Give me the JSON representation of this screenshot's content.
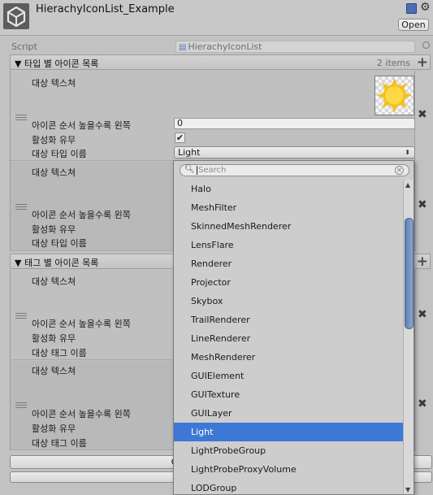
{
  "header": {
    "title": "HierachyIconList_Example",
    "open_label": "Open",
    "book_icon": "reference-book-icon",
    "gear_icon": "gear-icon"
  },
  "script_row": {
    "label": "Script",
    "value": "HierachyIconList"
  },
  "type_section": {
    "title": "타입 별 아이콘 목록",
    "count": "2 items",
    "items": [
      {
        "texture_label": "대상 텍스쳐",
        "order_label": "아이콘 순서 높을수록 왼쪽",
        "order_value": "0",
        "active_label": "활성화 유무",
        "active_checked": true,
        "type_label": "대상 타입 이름",
        "type_value": "Light"
      },
      {
        "texture_label": "대상 텍스쳐",
        "order_label": "아이콘 순서 높을수록 왼쪽",
        "active_label": "활성화 유무",
        "type_label": "대상 타입 이름"
      }
    ]
  },
  "tag_section": {
    "title": "태그 별 아이콘 목록",
    "items": [
      {
        "texture_label": "대상 텍스쳐",
        "order_label": "아이콘 순서 높을수록 왼쪽",
        "active_label": "활성화 유무",
        "tag_label": "대상 태그 이름"
      },
      {
        "texture_label": "대상 텍스쳐",
        "order_label": "아이콘 순서 높을수록 왼쪽",
        "active_label": "활성화 유무",
        "tag_label": "대상 태그 이름"
      }
    ]
  },
  "buttons": {
    "copy_label": "Copy ScriptableObject"
  },
  "popup": {
    "search_placeholder": "Search",
    "selected_index": 13,
    "items": [
      "Halo",
      "MeshFilter",
      "SkinnedMeshRenderer",
      "LensFlare",
      "Renderer",
      "Projector",
      "Skybox",
      "TrailRenderer",
      "LineRenderer",
      "MeshRenderer",
      "GUIElement",
      "GUITexture",
      "GUILayer",
      "Light",
      "LightProbeGroup",
      "LightProbeProxyVolume",
      "LODGroup"
    ]
  },
  "colors": {
    "selection": "#3d78d6",
    "scroll_thumb": "#6f8fbf",
    "background": "#c2c2c2"
  }
}
